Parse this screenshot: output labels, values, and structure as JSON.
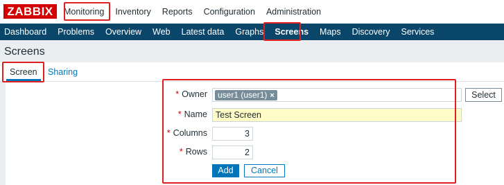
{
  "logo": "ZABBIX",
  "top_menu": [
    "Monitoring",
    "Inventory",
    "Reports",
    "Configuration",
    "Administration"
  ],
  "sub_menu": [
    "Dashboard",
    "Problems",
    "Overview",
    "Web",
    "Latest data",
    "Graphs",
    "Screens",
    "Maps",
    "Discovery",
    "Services"
  ],
  "page_title": "Screens",
  "tabs": [
    "Screen",
    "Sharing"
  ],
  "form": {
    "owner": {
      "label": "Owner",
      "tag": "user1 (user1)",
      "select_label": "Select"
    },
    "name": {
      "label": "Name",
      "value": "Test Screen"
    },
    "columns": {
      "label": "Columns",
      "value": "3"
    },
    "rows": {
      "label": "Rows",
      "value": "2"
    },
    "required_mark": "*",
    "add_label": "Add",
    "cancel_label": "Cancel"
  },
  "colors": {
    "logo_red": "#d40000",
    "nav_blue": "#0a466a",
    "link_blue": "#0275b8",
    "highlight_red": "#e02020",
    "name_input_bg": "#fffbc6"
  },
  "icons": {
    "tag_remove": "close-icon"
  }
}
